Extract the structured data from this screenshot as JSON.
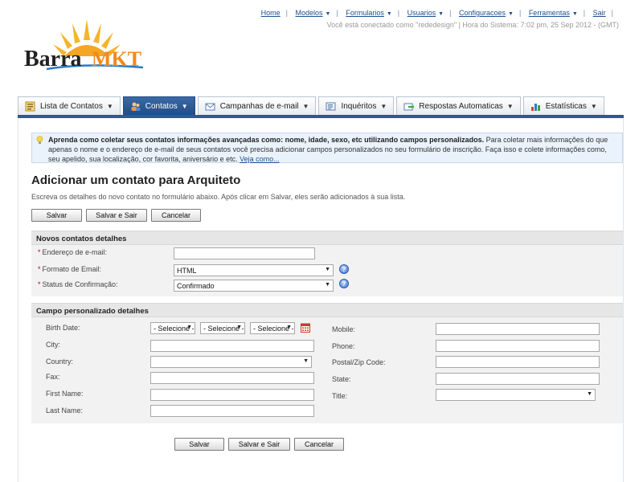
{
  "topnav": {
    "items": [
      {
        "label": "Home",
        "has_menu": false
      },
      {
        "label": "Modelos",
        "has_menu": true
      },
      {
        "label": "Formularios",
        "has_menu": true
      },
      {
        "label": "Usuarios",
        "has_menu": true
      },
      {
        "label": "Configuracoes",
        "has_menu": true
      },
      {
        "label": "Ferramentas",
        "has_menu": true
      },
      {
        "label": "Sair",
        "has_menu": false
      }
    ],
    "separator": "|",
    "system_info": "Você está conectado como \"rededesign\" | Hora do Sistema: 7:02 pm, 25 Sep 2012 - (GMT)"
  },
  "logo": {
    "text_part1": "Barra",
    "text_part2": "MKT"
  },
  "tabs": [
    {
      "label": "Lista de Contatos",
      "icon": "contact-list-icon",
      "active": false
    },
    {
      "label": "Contatos",
      "icon": "contacts-icon",
      "active": true
    },
    {
      "label": "Campanhas de e-mail",
      "icon": "email-campaign-icon",
      "active": false
    },
    {
      "label": "Inquéritos",
      "icon": "survey-icon",
      "active": false
    },
    {
      "label": "Respostas Automaticas",
      "icon": "autoresponder-icon",
      "active": false
    },
    {
      "label": "Estatísticas",
      "icon": "statistics-icon",
      "active": false
    }
  ],
  "tip": {
    "bold": "Aprenda como coletar seus contatos informações avançadas como: nome, idade, sexo, etc utilizando campos personalizados.",
    "text": " Para coletar mais informações do que apenas o nome e o endereço de e-mail de seus contatos você precisa adicionar campos personalizados no seu formulário de inscrição. Faça isso e colete informações como, seu apelido, sua localização, cor favorita, aniversário e etc. ",
    "link": "Veja como..."
  },
  "page": {
    "title": "Adicionar um contato para Arquiteto",
    "description": "Escreva os detalhes do novo contato no formulário abaixo. Após clicar em Salvar, eles serão adicionados à sua lista."
  },
  "buttons": {
    "save": "Salvar",
    "save_exit": "Salvar e Sair",
    "cancel": "Cancelar"
  },
  "section1": {
    "title": "Novos contatos detalhes",
    "email_label": "Endereço de e-mail:",
    "email_value": "",
    "format_label": "Formato de Email:",
    "format_value": "HTML",
    "status_label": "Status de Confirmação:",
    "status_value": "Confirmado",
    "required_mark": "*"
  },
  "section2": {
    "title": "Campo personalizado detalhes",
    "left_fields": [
      "Birth Date:",
      "City:",
      "Country:",
      "Fax:",
      "First Name:",
      "Last Name:"
    ],
    "right_fields": [
      "Mobile:",
      "Phone:",
      "Postal/Zip Code:",
      "State:",
      "Title:"
    ],
    "date_select": "- Selecione -",
    "help_glyph": "?"
  },
  "colors": {
    "link": "#1f4f8f",
    "tab_active": "#2a5a96",
    "tip_bg": "#eaf2fb",
    "required": "#cc0000"
  }
}
